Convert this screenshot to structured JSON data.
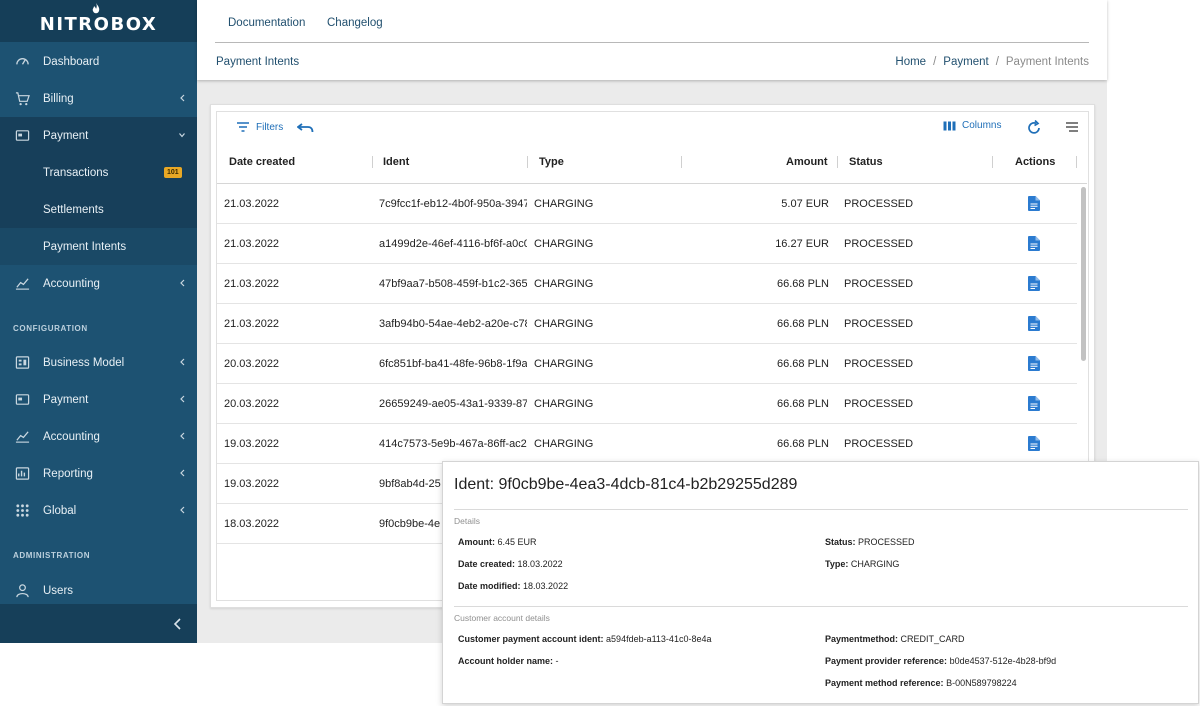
{
  "brand": {
    "name": "NITROBOX"
  },
  "sidebar": {
    "items": [
      {
        "label": "Dashboard",
        "icon": "dashboard-icon"
      },
      {
        "label": "Billing",
        "icon": "cart-icon"
      },
      {
        "label": "Payment",
        "icon": "payment-icon"
      },
      {
        "label": "Transactions",
        "badge": "101"
      },
      {
        "label": "Settlements"
      },
      {
        "label": "Payment Intents"
      },
      {
        "label": "Accounting",
        "icon": "chart-icon"
      }
    ],
    "configuration_title": "CONFIGURATION",
    "configuration_items": [
      {
        "label": "Business Model",
        "icon": "business-model-icon"
      },
      {
        "label": "Payment",
        "icon": "payment-icon"
      },
      {
        "label": "Accounting",
        "icon": "chart-icon"
      },
      {
        "label": "Reporting",
        "icon": "reporting-icon"
      },
      {
        "label": "Global",
        "icon": "global-icon"
      }
    ],
    "administration_title": "ADMINISTRATION",
    "administration_items": [
      {
        "label": "Users",
        "icon": "user-icon"
      }
    ]
  },
  "topnav": {
    "documentation": "Documentation",
    "changelog": "Changelog"
  },
  "page": {
    "title": "Payment Intents"
  },
  "breadcrumb": {
    "home": "Home",
    "payment": "Payment",
    "current": "Payment Intents",
    "separator": "/"
  },
  "toolbar": {
    "filters": "Filters",
    "columns": "Columns"
  },
  "table": {
    "headers": {
      "date": "Date created",
      "ident": "Ident",
      "type": "Type",
      "amount": "Amount",
      "status": "Status",
      "actions": "Actions"
    },
    "rows": [
      {
        "date": "21.03.2022",
        "ident": "7c9fcc1f-eb12-4b0f-950a-3947",
        "type": "CHARGING",
        "amount": "5.07 EUR",
        "status": "PROCESSED"
      },
      {
        "date": "21.03.2022",
        "ident": "a1499d2e-46ef-4116-bf6f-a0c0",
        "type": "CHARGING",
        "amount": "16.27 EUR",
        "status": "PROCESSED"
      },
      {
        "date": "21.03.2022",
        "ident": "47bf9aa7-b508-459f-b1c2-365",
        "type": "CHARGING",
        "amount": "66.68 PLN",
        "status": "PROCESSED"
      },
      {
        "date": "21.03.2022",
        "ident": "3afb94b0-54ae-4eb2-a20e-c78",
        "type": "CHARGING",
        "amount": "66.68 PLN",
        "status": "PROCESSED"
      },
      {
        "date": "20.03.2022",
        "ident": "6fc851bf-ba41-48fe-96b8-1f9a",
        "type": "CHARGING",
        "amount": "66.68 PLN",
        "status": "PROCESSED"
      },
      {
        "date": "20.03.2022",
        "ident": "26659249-ae05-43a1-9339-87",
        "type": "CHARGING",
        "amount": "66.68 PLN",
        "status": "PROCESSED"
      },
      {
        "date": "19.03.2022",
        "ident": "414c7573-5e9b-467a-86ff-ac2",
        "type": "CHARGING",
        "amount": "66.68 PLN",
        "status": "PROCESSED"
      },
      {
        "date": "19.03.2022",
        "ident": "9bf8ab4d-25",
        "type": "",
        "amount": "",
        "status": ""
      },
      {
        "date": "18.03.2022",
        "ident": "9f0cb9be-4e",
        "type": "",
        "amount": "",
        "status": ""
      }
    ]
  },
  "detail": {
    "title": "Ident: 9f0cb9be-4ea3-4dcb-81c4-b2b29255d289",
    "details_label": "Details",
    "amount_label": "Amount:",
    "amount": "6.45 EUR",
    "date_created_label": "Date created:",
    "date_created": "18.03.2022",
    "date_modified_label": "Date modified:",
    "date_modified": "18.03.2022",
    "status_label": "Status:",
    "status": "PROCESSED",
    "type_label": "Type:",
    "type": "CHARGING",
    "customer_label": "Customer account details",
    "cpai_label": "Customer payment account ident:",
    "cpai": "a594fdeb-a113-41c0-8e4a",
    "holder_label": "Account holder name:",
    "holder": "-",
    "pm_label": "Paymentmethod:",
    "pm": "CREDIT_CARD",
    "ppr_label": "Payment provider reference:",
    "ppr": "b0de4537-512e-4b28-bf9d",
    "pmr_label": "Payment method reference:",
    "pmr": "B-00N589798224"
  },
  "colors": {
    "sidebar": "#1d5272",
    "accent": "#1f6fb8",
    "badge": "#e9a825"
  }
}
